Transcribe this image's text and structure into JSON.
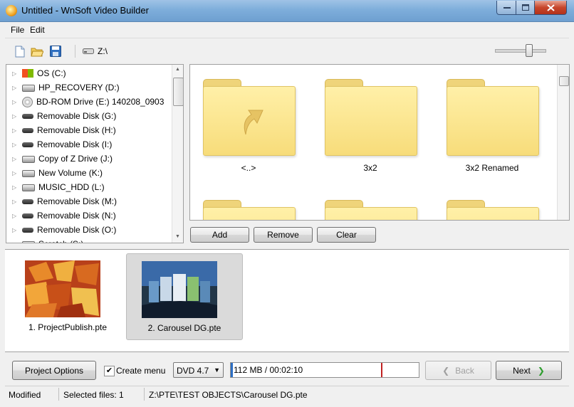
{
  "window": {
    "title": "Untitled - WnSoft Video Builder"
  },
  "menu": {
    "items": [
      "File",
      "Edit"
    ]
  },
  "toolbar": {
    "path": "Z:\\",
    "zoom_level": 0.65
  },
  "tree": {
    "items": [
      {
        "label": "OS (C:)",
        "icon": "windows-drive-icon"
      },
      {
        "label": "HP_RECOVERY (D:)",
        "icon": "hard-disk-icon"
      },
      {
        "label": "BD-ROM Drive (E:) 140208_0903",
        "icon": "optical-disc-icon"
      },
      {
        "label": "Removable Disk (G:)",
        "icon": "removable-disk-icon"
      },
      {
        "label": "Removable Disk (H:)",
        "icon": "removable-disk-icon"
      },
      {
        "label": "Removable Disk (I:)",
        "icon": "removable-disk-icon"
      },
      {
        "label": "Copy of Z Drive (J:)",
        "icon": "hard-disk-icon"
      },
      {
        "label": "New Volume (K:)",
        "icon": "hard-disk-icon"
      },
      {
        "label": "MUSIC_HDD (L:)",
        "icon": "hard-disk-icon"
      },
      {
        "label": "Removable Disk (M:)",
        "icon": "removable-disk-icon"
      },
      {
        "label": "Removable Disk (N:)",
        "icon": "removable-disk-icon"
      },
      {
        "label": "Removable Disk (O:)",
        "icon": "removable-disk-icon"
      },
      {
        "label": "Scratch (S:)",
        "icon": "hard-disk-icon"
      }
    ]
  },
  "browser": {
    "folders": [
      {
        "label": "<..>",
        "up": true
      },
      {
        "label": "3x2",
        "up": false
      },
      {
        "label": "3x2 Renamed",
        "up": false
      }
    ]
  },
  "actions": {
    "add": "Add",
    "remove": "Remove",
    "clear": "Clear"
  },
  "projects": [
    {
      "label": "1. ProjectPublish.pte",
      "selected": false
    },
    {
      "label": "2. Carousel DG.pte",
      "selected": true
    }
  ],
  "bottom": {
    "project_options": "Project Options",
    "create_menu_label": "Create menu",
    "create_menu_checked": true,
    "disc_type": "DVD 4.7",
    "progress_text": "112 MB / 00:02:10",
    "capacity_marker": 0.8,
    "back": "Back",
    "next": "Next"
  },
  "status": {
    "state": "Modified",
    "selected": "Selected files: 1",
    "path": "Z:\\PTE\\TEST OBJECTS\\Carousel DG.pte"
  },
  "colors": {
    "folder": "#f7dc7a",
    "accent": "#2d6fc4",
    "marker": "#c02020",
    "next_arrow": "#2e9e2e"
  }
}
